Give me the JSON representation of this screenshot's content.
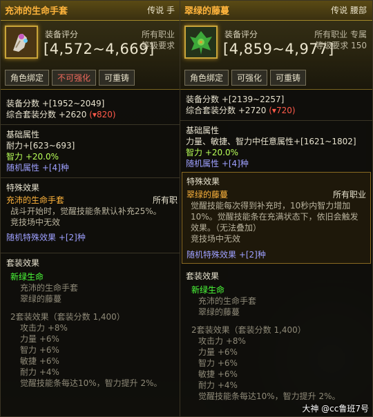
{
  "left": {
    "title": "充沛的生命手套",
    "tag": "传说 手",
    "icon": "glove-icon",
    "score_label": "装备评分",
    "score": "[4,572~4,669]",
    "job": "所有职业",
    "level": "等级要求",
    "buttons": [
      "角色绑定",
      "不可强化",
      "可重铸"
    ],
    "equip_score": "装备分数 +[1952~2049]",
    "set_score": "综合套装分数 +2620",
    "set_score_delta": "(▾820)",
    "basic_title": "基础属性",
    "basic_lines": [
      "耐力+[623~693]"
    ],
    "basic_green": "智力 +20.0%",
    "basic_random": "随机属性 +[4]种",
    "special_title": "特殊效果",
    "special_name": "充沛的生命手套",
    "special_job": "所有职",
    "special_lines": [
      "战斗开始时，觉醒技能条默认补充25%。",
      "竞技场中无效"
    ],
    "special_random": "随机特殊效果 +[2]种",
    "set_title": "套装效果",
    "set_name": "新绿生命",
    "set_items": [
      "充沛的生命手套",
      "翠绿的藤蔓"
    ],
    "set2_title": "2套装效果（套装分数 1,400）",
    "set2_lines": [
      "攻击力 +8%",
      "力量 +6%",
      "智力 +6%",
      "敏捷 +6%",
      "耐力 +4%",
      "觉醒技能条每达10%，智力提升 2%。"
    ]
  },
  "right": {
    "title": "翠绿的藤蔓",
    "tag": "传说 腰部",
    "icon": "vine-icon",
    "score_label": "装备评分",
    "score": "[4,859~4,977]",
    "job": "所有职业 专属",
    "level": "等级要求 150",
    "buttons": [
      "角色绑定",
      "可强化",
      "可重铸"
    ],
    "equip_score": "装备分数 +[2139~2257]",
    "set_score": "综合套装分数 +2720",
    "set_score_delta": "(▾720)",
    "basic_title": "基础属性",
    "basic_lines": [
      "力量、敏捷、智力中任意属性+[1621~1802]"
    ],
    "basic_green": "智力 +20.0%",
    "basic_random": "随机属性 +[4]种",
    "special_title": "特殊效果",
    "special_name": "翠绿的藤蔓",
    "special_job": "所有职业",
    "special_lines": [
      "觉醒技能每次得到补充时，10秒内智力增加",
      "10%。觉醒技能条在充满状态下，依旧会触发",
      "效果。（无法叠加）",
      "竞技场中无效"
    ],
    "special_random": "随机特殊效果 +[2]种",
    "set_title": "套装效果",
    "set_name": "新绿生命",
    "set_items": [
      "充沛的生命手套",
      "翠绿的藤蔓"
    ],
    "set2_title": "2套装效果（套装分数 1,400）",
    "set2_lines": [
      "攻击力 +8%",
      "力量 +6%",
      "智力 +6%",
      "敏捷 +6%",
      "耐力 +4%",
      "觉醒技能条每达10%，智力提升 2%。"
    ]
  },
  "watermark": "大神 @cc鲁班7号",
  "colors": {
    "gold": "#ffb43c",
    "green": "#b8ff58",
    "blue": "#9ea0ff",
    "set": "#4cff3a",
    "red": "#f06a5c"
  }
}
